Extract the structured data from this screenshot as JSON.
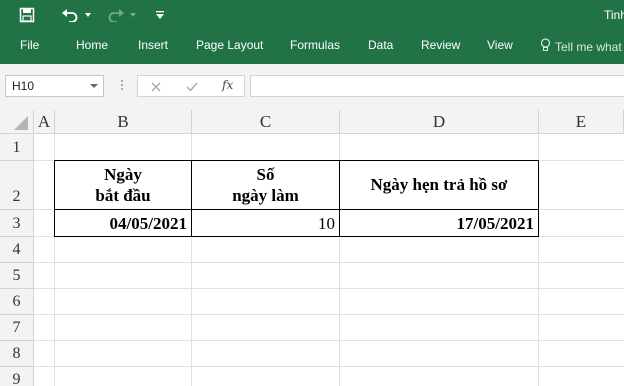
{
  "app": {
    "title_partial": "Tinh",
    "colors": {
      "ribbon": "#217346",
      "grid_line": "#e1e1e1",
      "header_bg": "#f3f3f3"
    }
  },
  "quick_access": [
    {
      "name": "save-icon"
    },
    {
      "name": "undo-icon"
    },
    {
      "name": "redo-icon"
    },
    {
      "name": "customize-qat-icon"
    }
  ],
  "ribbon": {
    "tabs": [
      "File",
      "Home",
      "Insert",
      "Page Layout",
      "Formulas",
      "Data",
      "Review",
      "View"
    ],
    "tell_me": "Tell me what"
  },
  "formula_bar": {
    "name_box": "H10",
    "fx_label": "fx",
    "formula": ""
  },
  "sheet": {
    "columns": [
      "A",
      "B",
      "C",
      "D",
      "E"
    ],
    "rows": [
      "1",
      "2",
      "3",
      "4",
      "5",
      "6",
      "7",
      "8",
      "9"
    ],
    "cells": {
      "B2_line1": "Ngày",
      "B2_line2": "bắt đầu",
      "C2_line1": "Số",
      "C2_line2": "ngày làm",
      "D2": "Ngày hẹn trả hồ sơ",
      "B3": "04/05/2021",
      "C3": "10",
      "D3": "17/05/2021"
    }
  }
}
